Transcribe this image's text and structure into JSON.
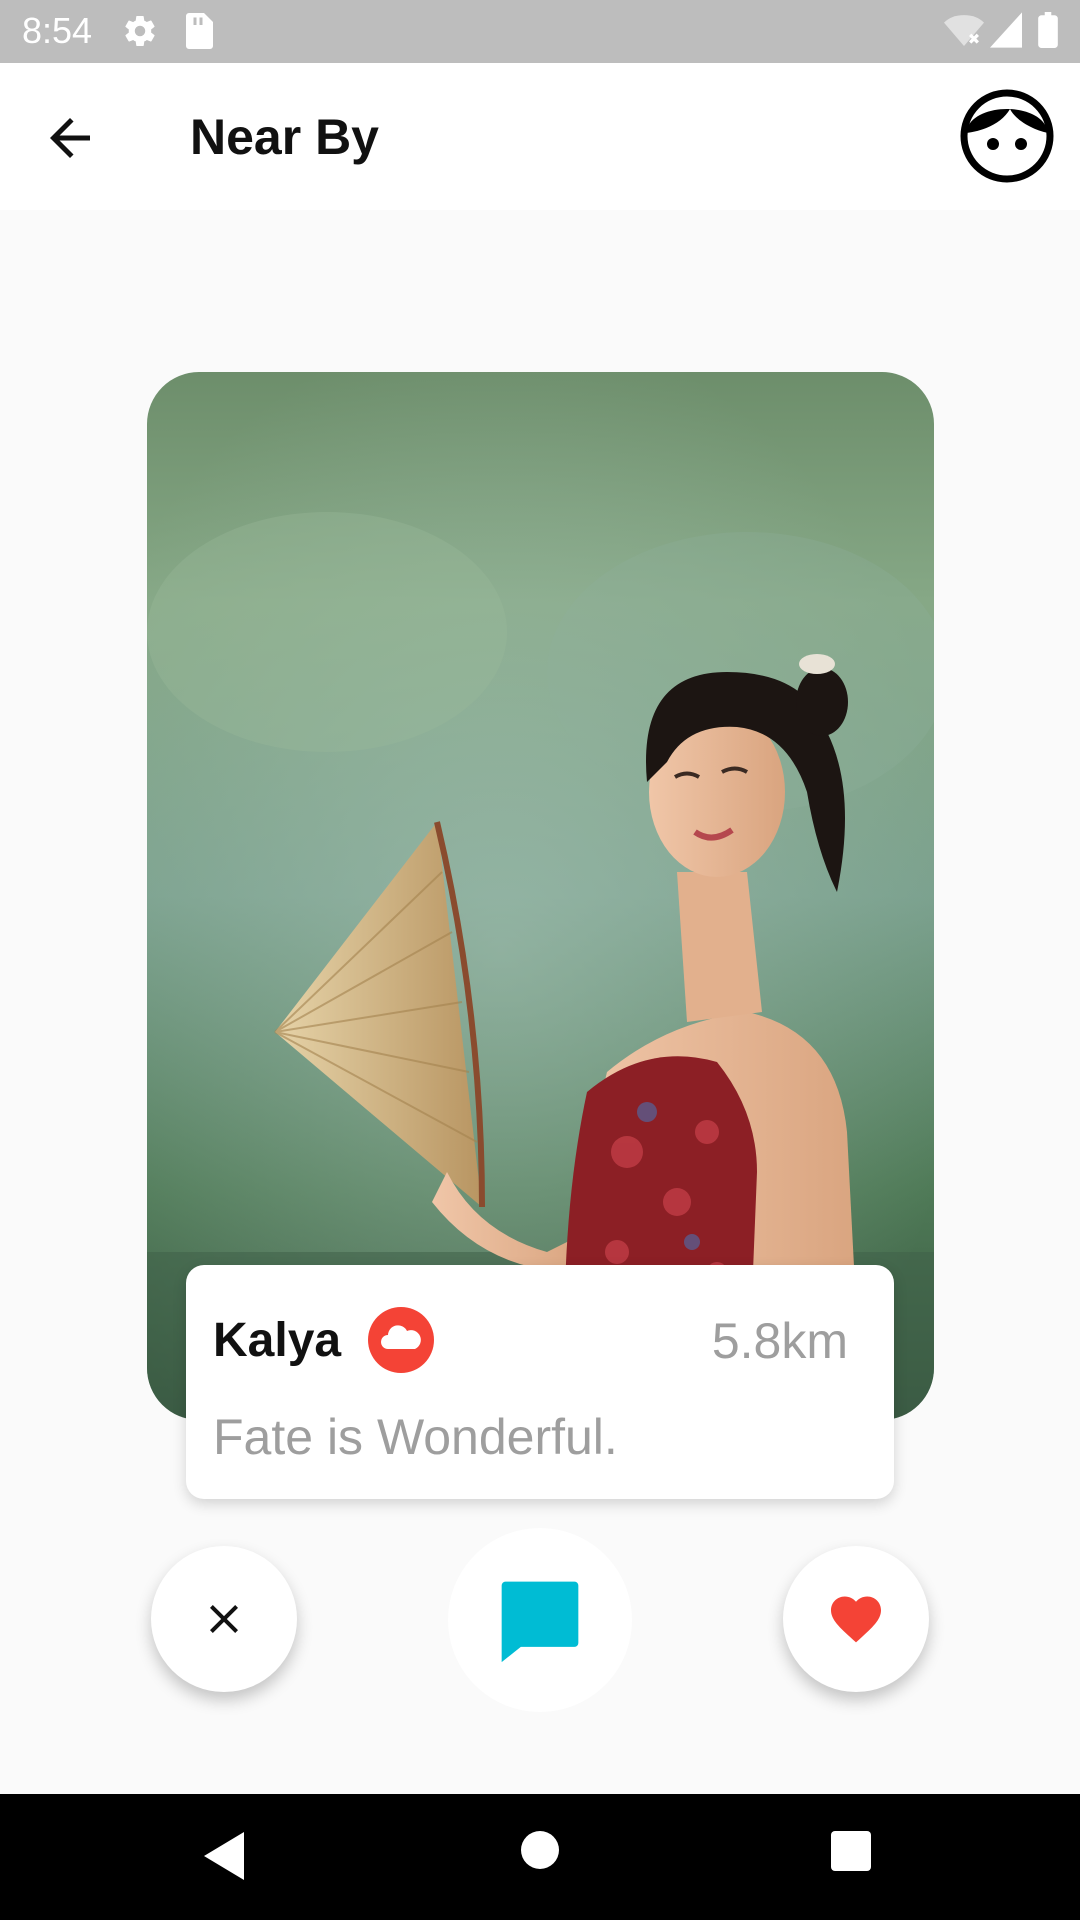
{
  "status_bar": {
    "time": "8:54",
    "icons": [
      "gear-icon",
      "sd-card-icon",
      "wifi-off-icon",
      "signal-icon",
      "battery-icon"
    ]
  },
  "app_bar": {
    "title": "Near By",
    "back_icon": "arrow-back-icon",
    "profile_icon": "face-icon"
  },
  "profile_card": {
    "photo": "portrait photo of a smiling woman holding a conical straw hat",
    "name": "Kalya",
    "status_icon": "cloud-icon",
    "distance": "5.8km",
    "motto": "Fate is Wonderful."
  },
  "actions": {
    "dislike_icon": "close-icon",
    "message_icon": "chat-bubble-icon",
    "like_icon": "heart-icon"
  },
  "nav_bar": {
    "icons": [
      "back-triangle-icon",
      "home-circle-icon",
      "recents-square-icon"
    ]
  },
  "colors": {
    "status_bar": "#bdbdbd",
    "cloud_badge": "#f44336",
    "message_accent": "#00bcd4",
    "like_heart": "#f44336",
    "secondary_text": "#9e9e9e",
    "background": "#fafafa"
  }
}
